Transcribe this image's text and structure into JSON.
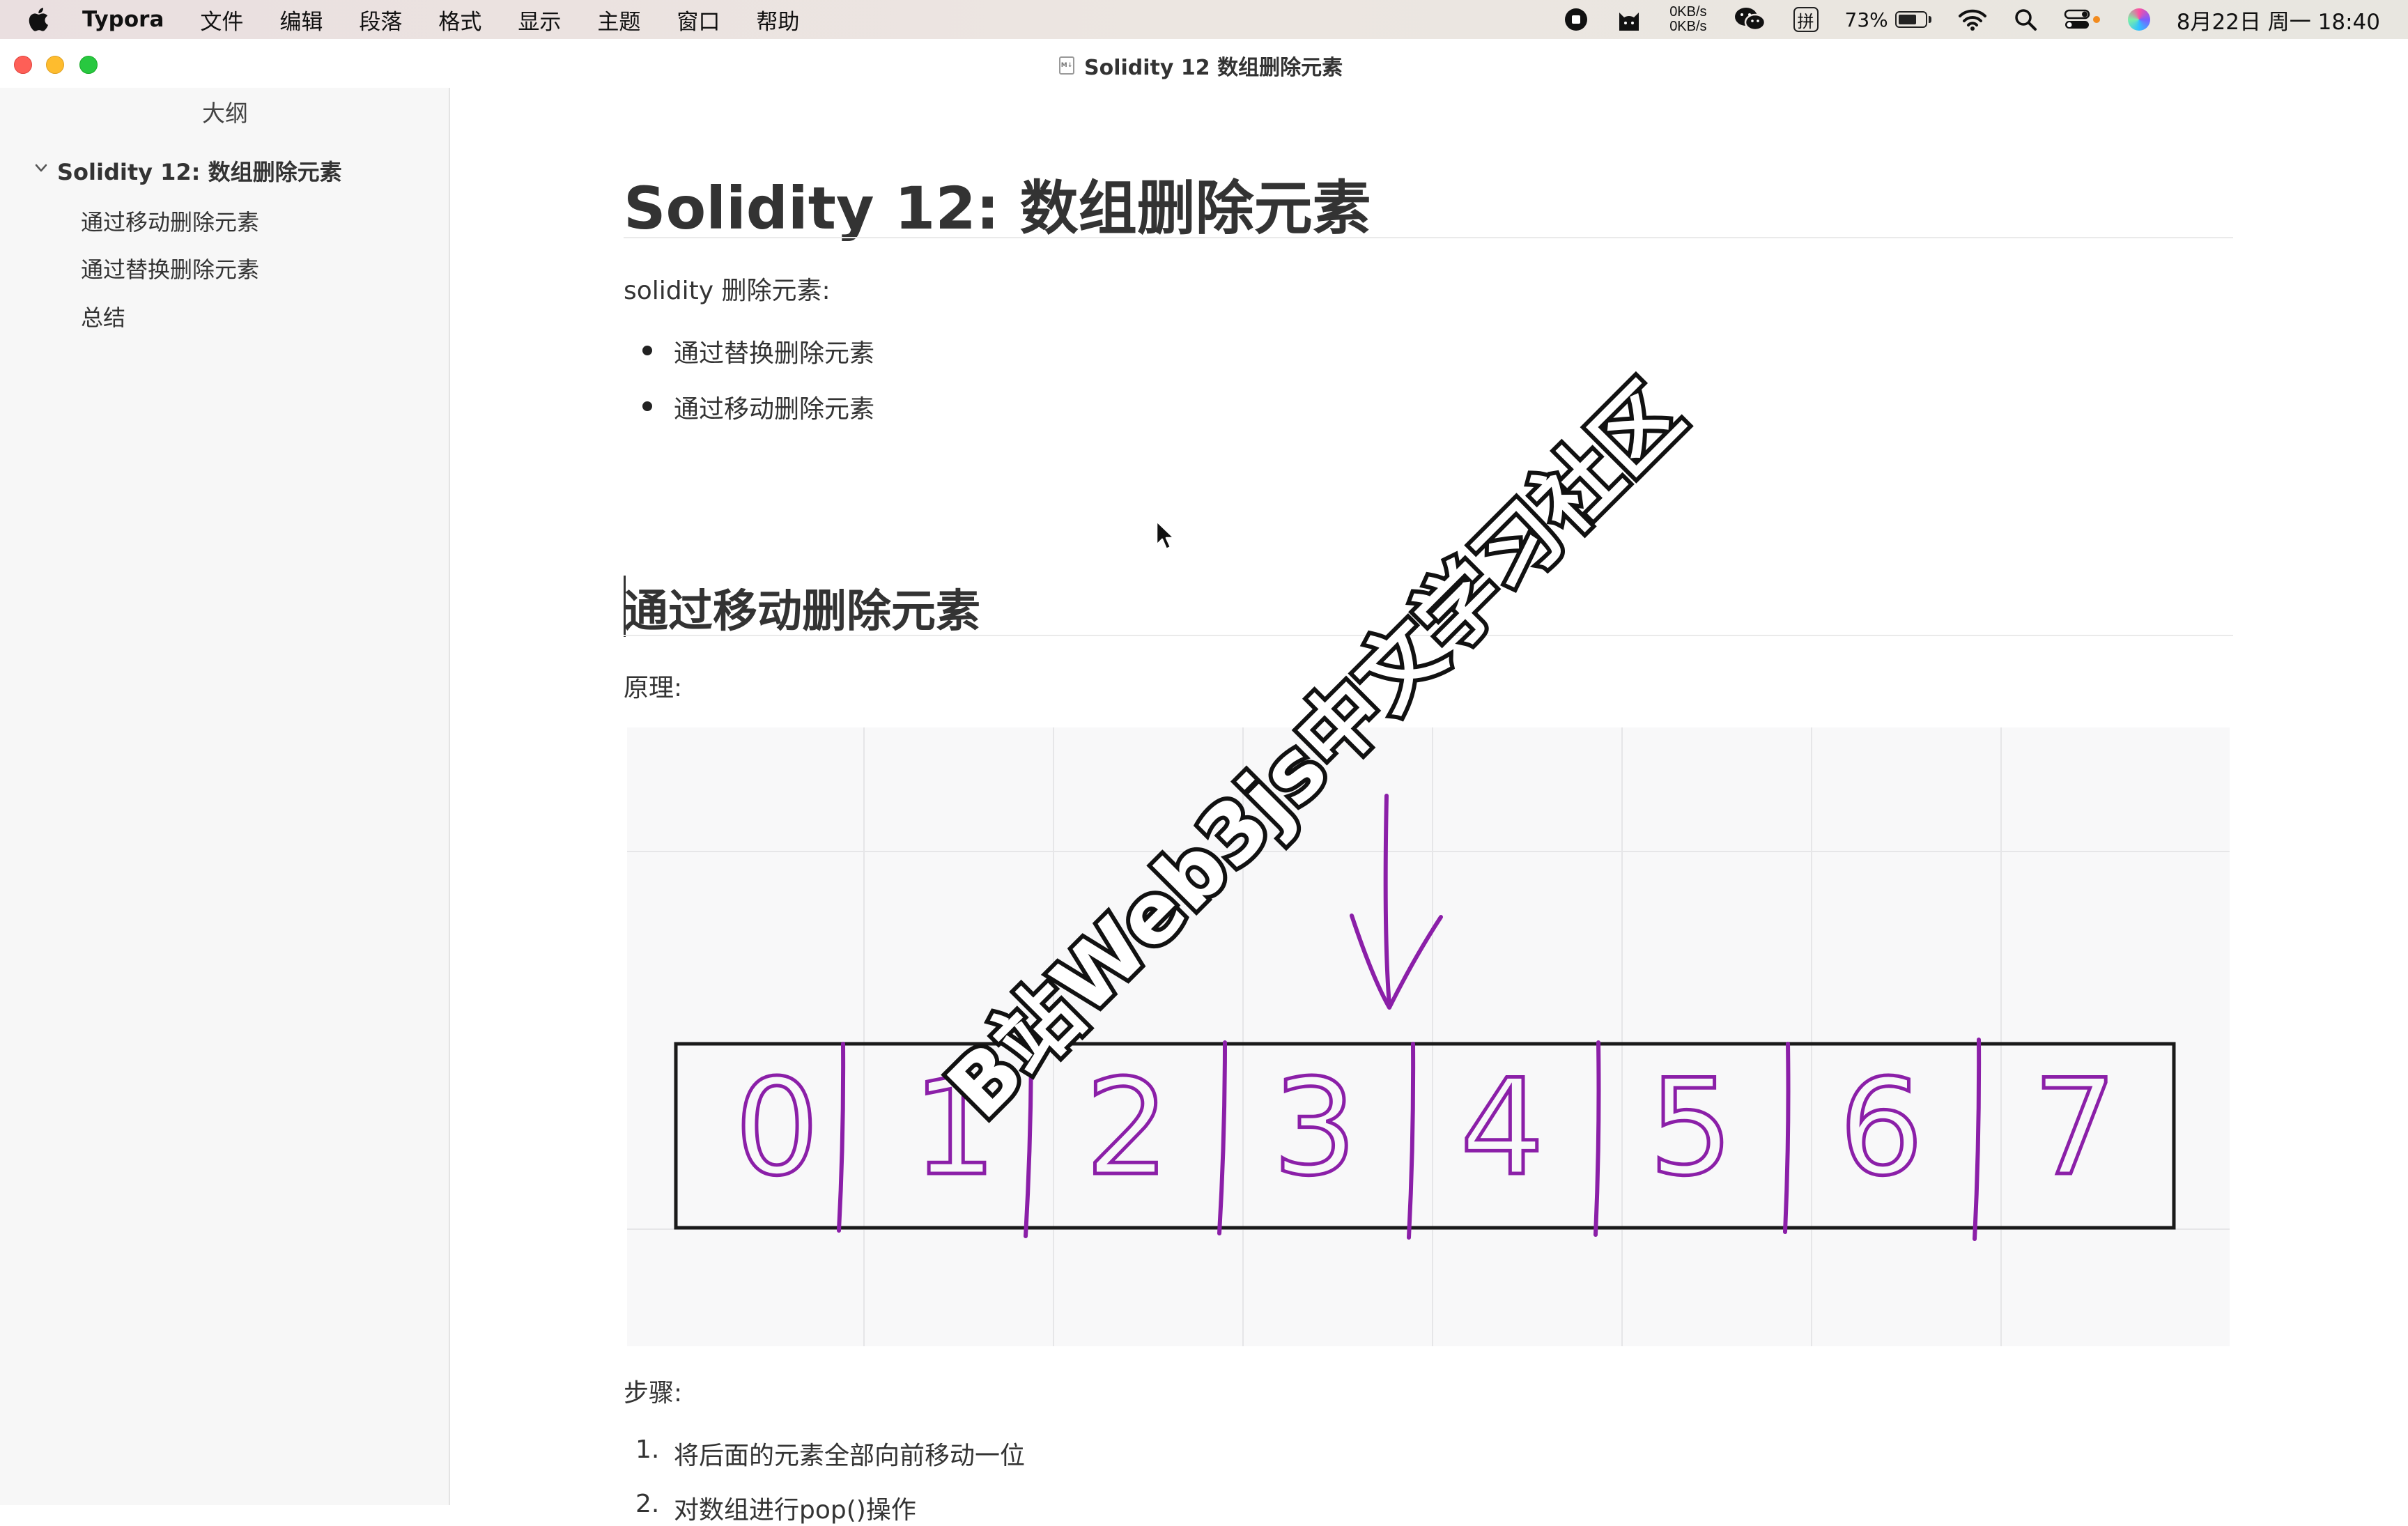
{
  "menubar": {
    "app_name": "Typora",
    "items": [
      "文件",
      "编辑",
      "段落",
      "格式",
      "显示",
      "主题",
      "窗口",
      "帮助"
    ],
    "status": {
      "net_up": "0KB/s",
      "net_down": "0KB/s",
      "input_method": "拼",
      "battery": "73%",
      "battery_level": 0.73,
      "datetime": "8月22日 周一  18:40"
    }
  },
  "window": {
    "title": "Solidity 12 数组删除元素"
  },
  "sidebar": {
    "title": "大纲",
    "outline": [
      {
        "label": "Solidity 12: 数组删除元素",
        "level": 1,
        "expanded": true
      },
      {
        "label": "通过移动删除元素",
        "level": 2
      },
      {
        "label": "通过替换删除元素",
        "level": 2
      },
      {
        "label": "总结",
        "level": 2
      }
    ]
  },
  "document": {
    "h1": "Solidity 12: 数组删除元素",
    "intro": "solidity 删除元素:",
    "bullets": [
      "通过替换删除元素",
      "通过移动删除元素"
    ],
    "h2": "通过移动删除元素",
    "principle_label": "原理:",
    "diagram": {
      "digits": [
        "0",
        "1",
        "2",
        "3",
        "4",
        "5",
        "6",
        "7"
      ],
      "ink_color": "#8b1fa8"
    },
    "steps_label": "步骤:",
    "steps": [
      "将后面的元素全部向前移动一位",
      "对数组进行pop()操作"
    ],
    "step_numbers": [
      "1.",
      "2."
    ]
  },
  "watermark": "B站Web3js中文学习社区",
  "colors": {
    "close": "#fe5f57",
    "minimize": "#febc2e",
    "zoom": "#28c840",
    "sidebar_bg": "#f7f7f7",
    "diagram_bg": "#f8f8f9"
  }
}
